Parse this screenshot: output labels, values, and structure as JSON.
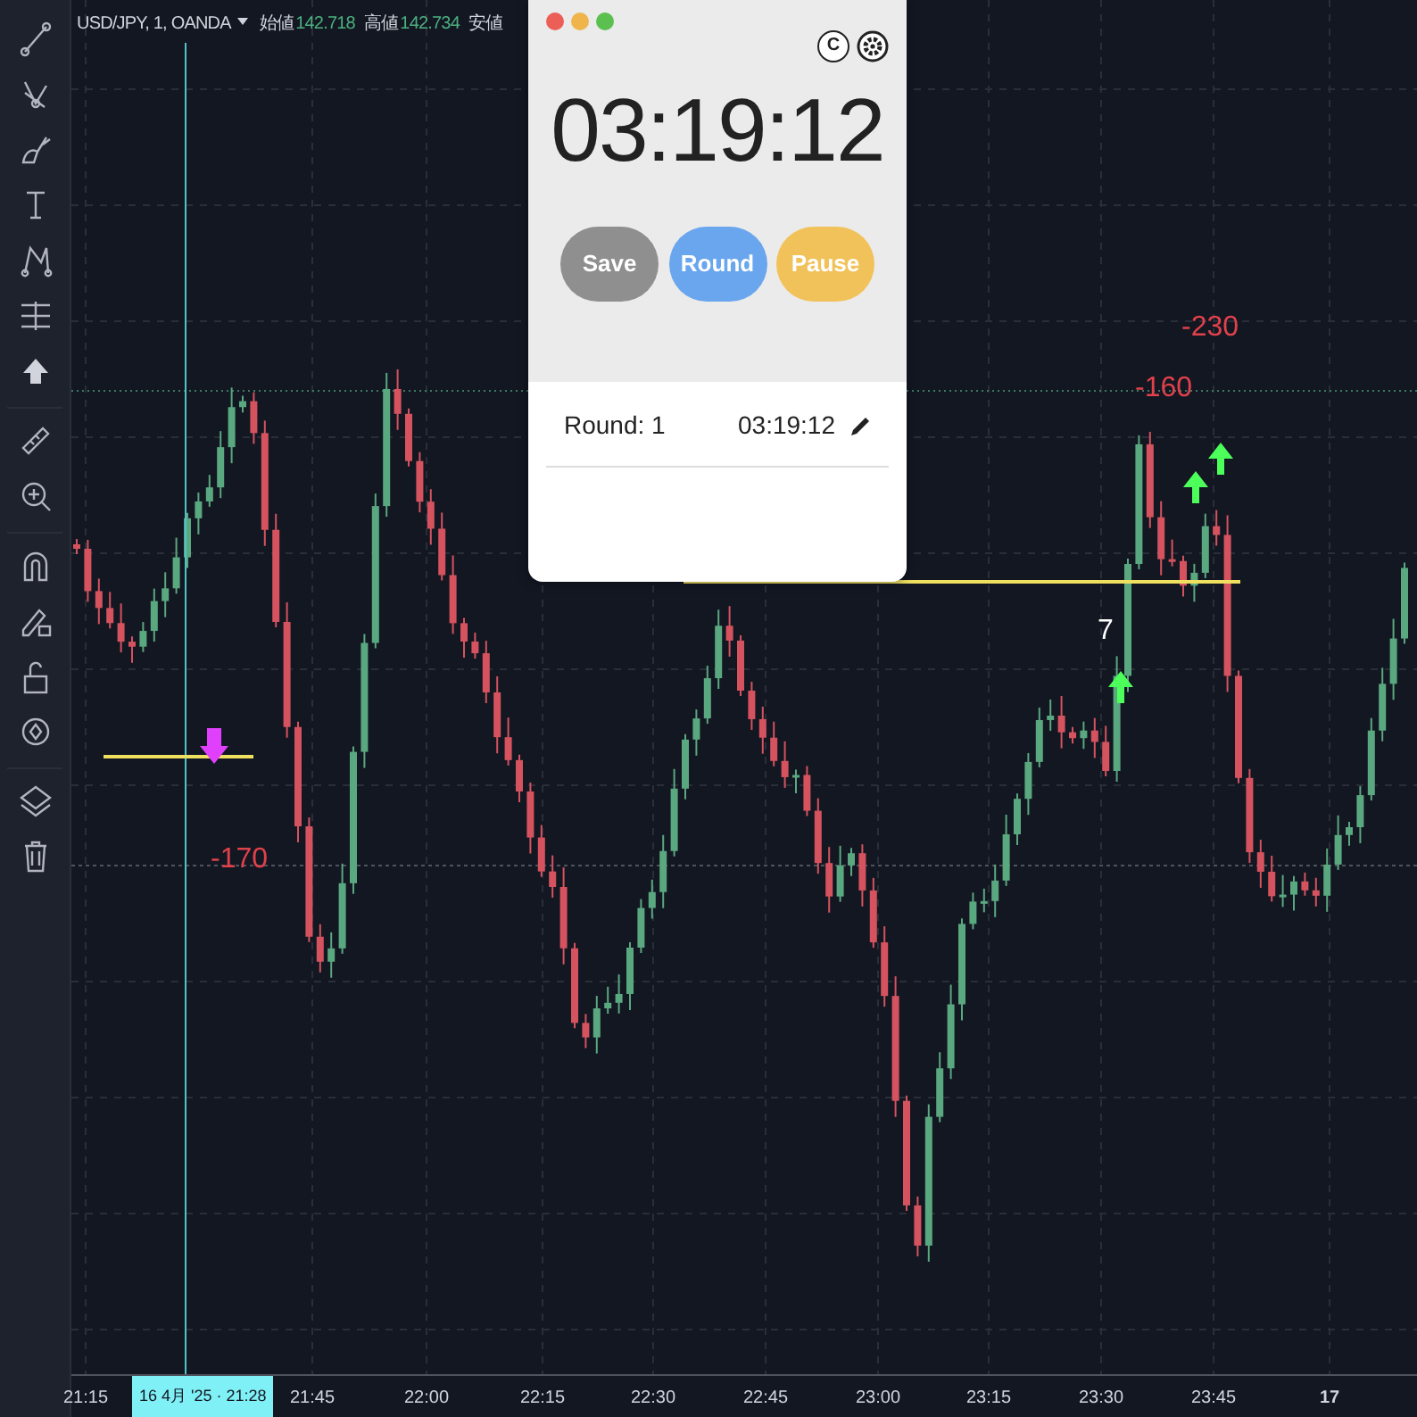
{
  "header": {
    "symbol": "USD/JPY, 1, OANDA",
    "quotes": [
      {
        "label": "始値",
        "value": "142.718"
      },
      {
        "label": "高値",
        "value": "142.734"
      },
      {
        "label": "安値"
      }
    ]
  },
  "annotations": [
    {
      "text": "-230",
      "kind": "loss"
    },
    {
      "text": "-160",
      "kind": "loss"
    },
    {
      "text": "-170",
      "kind": "loss"
    },
    {
      "text": "7",
      "kind": "count"
    }
  ],
  "time_axis": {
    "labels": [
      "21:15",
      "21:45",
      "22:00",
      "22:15",
      "22:30",
      "22:45",
      "23:00",
      "23:15",
      "23:30",
      "23:45",
      "17"
    ],
    "cursor_label": "16 4月 '25 · 21:28"
  },
  "stopwatch": {
    "reset_label": "C",
    "time": "03:19:12",
    "buttons": [
      {
        "label": "Save",
        "kind": "save",
        "disabled": true
      },
      {
        "label": "Round",
        "kind": "round",
        "disabled": false
      },
      {
        "label": "Pause",
        "kind": "pause",
        "disabled": false
      }
    ],
    "rounds": [
      {
        "label": "Round: 1",
        "time": "03:19:12"
      }
    ]
  }
}
